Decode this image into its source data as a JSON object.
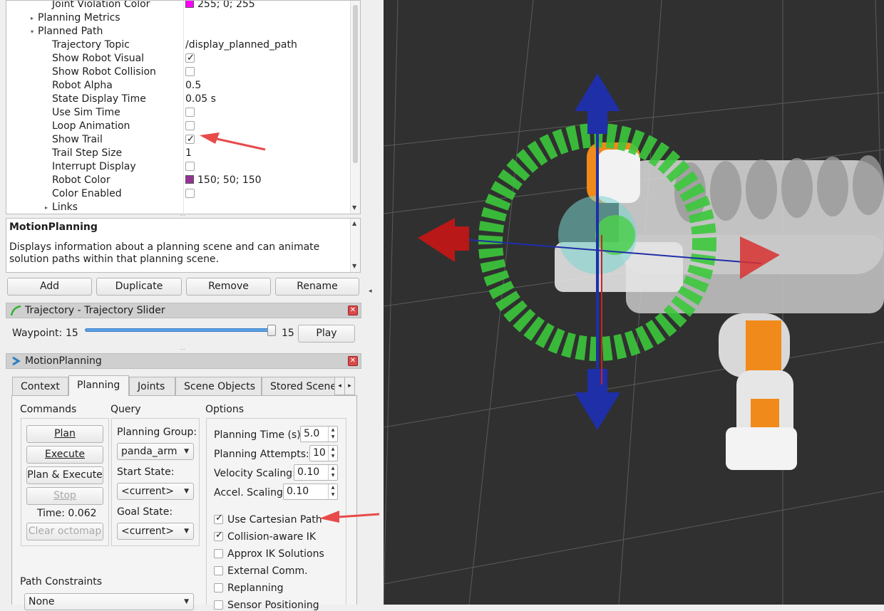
{
  "property_tree": {
    "rows": [
      {
        "name": "Joint Violation Color",
        "indent": 72,
        "value": "255; 0; 255",
        "kind": "color",
        "color": "#ff00ff"
      },
      {
        "name": "Planning Metrics",
        "indent": 52,
        "arrow": "▸",
        "value": "",
        "kind": "text"
      },
      {
        "name": "Planned Path",
        "indent": 52,
        "arrow": "▾",
        "value": "",
        "kind": "text"
      },
      {
        "name": "Trajectory Topic",
        "indent": 72,
        "value": "/display_planned_path",
        "kind": "text"
      },
      {
        "name": "Show Robot Visual",
        "indent": 72,
        "value": "",
        "kind": "check",
        "checked": true
      },
      {
        "name": "Show Robot Collision",
        "indent": 72,
        "value": "",
        "kind": "check",
        "checked": false
      },
      {
        "name": "Robot Alpha",
        "indent": 72,
        "value": "0.5",
        "kind": "text"
      },
      {
        "name": "State Display Time",
        "indent": 72,
        "value": "0.05 s",
        "kind": "text"
      },
      {
        "name": "Use Sim Time",
        "indent": 72,
        "value": "",
        "kind": "check",
        "checked": false
      },
      {
        "name": "Loop Animation",
        "indent": 72,
        "value": "",
        "kind": "check",
        "checked": false
      },
      {
        "name": "Show Trail",
        "indent": 72,
        "value": "",
        "kind": "check",
        "checked": true
      },
      {
        "name": "Trail Step Size",
        "indent": 72,
        "value": "1",
        "kind": "text"
      },
      {
        "name": "Interrupt Display",
        "indent": 72,
        "value": "",
        "kind": "check",
        "checked": false
      },
      {
        "name": "Robot Color",
        "indent": 72,
        "value": "150; 50; 150",
        "kind": "color",
        "color": "#963296"
      },
      {
        "name": "Color Enabled",
        "indent": 72,
        "value": "",
        "kind": "check",
        "checked": false
      },
      {
        "name": "Links",
        "indent": 72,
        "arrow": "▸",
        "value": "",
        "kind": "text"
      }
    ]
  },
  "description": {
    "title": "MotionPlanning",
    "text": "Displays information about a planning scene and can animate solution paths within that planning scene."
  },
  "display_buttons": {
    "add": "Add",
    "duplicate": "Duplicate",
    "remove": "Remove",
    "rename": "Rename"
  },
  "trajectory_panel": {
    "title": "Trajectory - Trajectory Slider",
    "waypoint_label": "Waypoint:",
    "waypoint_value": "15",
    "slider_max": "15",
    "slider_fraction": 1.0,
    "play": "Play"
  },
  "motion_panel": {
    "title": "MotionPlanning",
    "tabs": [
      "Context",
      "Planning",
      "Joints",
      "Scene Objects",
      "Stored Scene"
    ],
    "active_tab": 1
  },
  "commands": {
    "label": "Commands",
    "plan": "Plan",
    "execute": "Execute",
    "plan_execute": "Plan & Execute",
    "stop": "Stop",
    "time": "Time: 0.062",
    "clear_octomap": "Clear octomap"
  },
  "query": {
    "label": "Query",
    "planning_group_label": "Planning Group:",
    "planning_group": "panda_arm",
    "start_state_label": "Start State:",
    "start_state": "<current>",
    "goal_state_label": "Goal State:",
    "goal_state": "<current>"
  },
  "options": {
    "label": "Options",
    "planning_time_label": "Planning Time (s):",
    "planning_time": "5.0",
    "planning_attempts_label": "Planning Attempts:",
    "planning_attempts": "10",
    "velocity_label": "Velocity Scaling:",
    "velocity": "0.10",
    "accel_label": "Accel. Scaling:",
    "accel": "0.10",
    "checkboxes": [
      {
        "label": "Use Cartesian Path",
        "checked": true
      },
      {
        "label": "Collision-aware IK",
        "checked": true
      },
      {
        "label": "Approx IK Solutions",
        "checked": false
      },
      {
        "label": "External Comm.",
        "checked": false
      },
      {
        "label": "Replanning",
        "checked": false
      },
      {
        "label": "Sensor Positioning",
        "checked": false
      }
    ]
  },
  "path_constraints": {
    "label": "Path Constraints",
    "value": "None"
  },
  "colors": {
    "viewport_bg": "#303030",
    "marker_ring": "#3cc83c",
    "arrow_blue": "#1f2fa8",
    "arrow_red": "#b81818",
    "robot_orange": "#f08a1a",
    "annotation_red": "#e84a4a"
  }
}
